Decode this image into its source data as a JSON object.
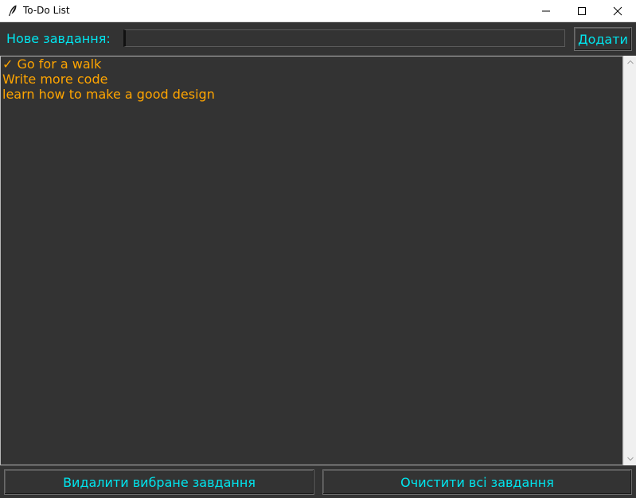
{
  "window": {
    "title": "To-Do List",
    "icon": "feather-icon"
  },
  "form": {
    "label": "Нове завдання:",
    "input_value": "",
    "add_label": "Додати"
  },
  "tasks": [
    "✓ Go for a walk",
    "Write more code",
    "learn how to make a good design"
  ],
  "actions": {
    "delete_label": "Видалити вибране завдання",
    "clear_label": "Очистити всі завдання"
  },
  "colors": {
    "background": "#333333",
    "accent_text": "#00e5ee",
    "task_text": "#ffa500"
  }
}
